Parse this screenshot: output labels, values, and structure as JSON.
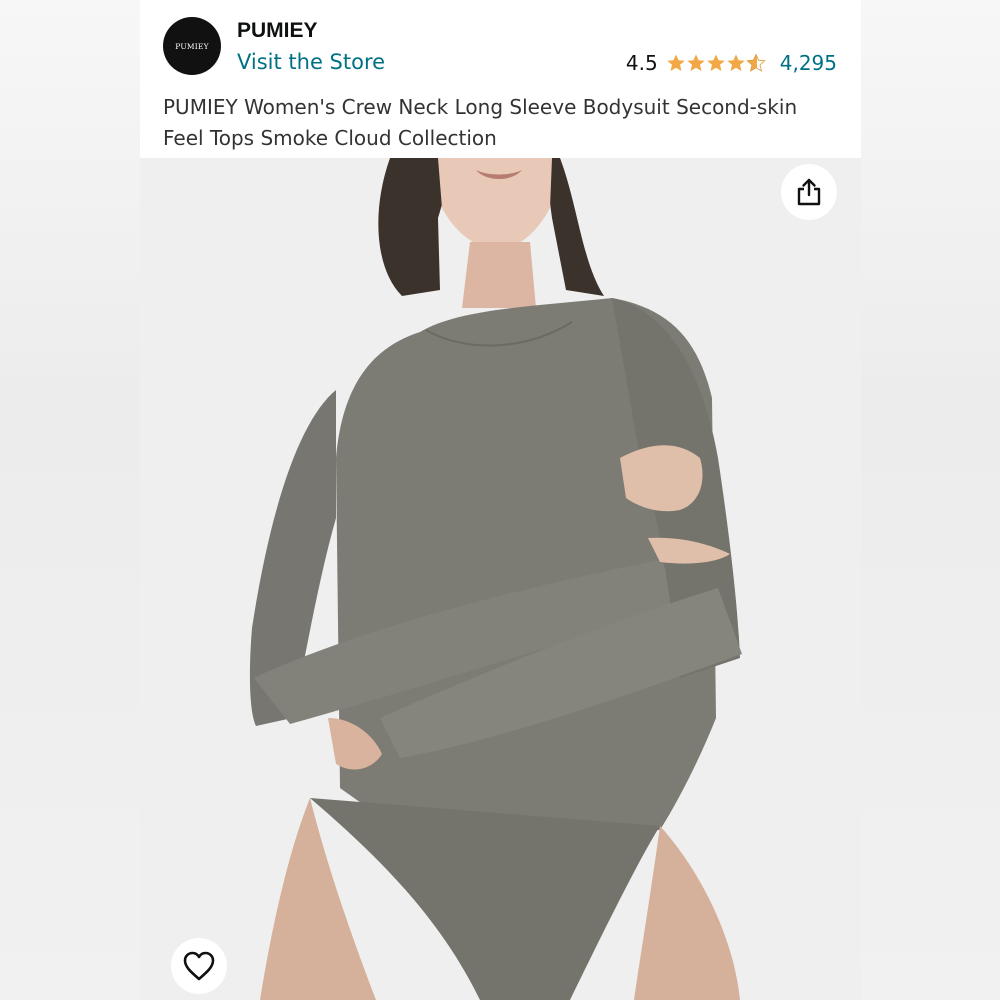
{
  "brand": {
    "logo_text": "PUMIEY",
    "name": "PUMIEY",
    "store_link": "Visit the Store"
  },
  "rating": {
    "value": "4.5",
    "stars": 4.5,
    "count": "4,295",
    "star_color": "#f3a847"
  },
  "product": {
    "title": "PUMIEY Women's Crew Neck Long Sleeve Bodysuit Second-skin Feel Tops Smoke Cloud Collection",
    "image_subject": "model wearing a grey long sleeve crew neck bodysuit with arms crossed"
  },
  "actions": {
    "share_icon": "share-icon",
    "wishlist_icon": "heart-icon"
  },
  "colors": {
    "link": "#007185",
    "bodysuit": "#7d7c74",
    "background": "#efefef"
  }
}
